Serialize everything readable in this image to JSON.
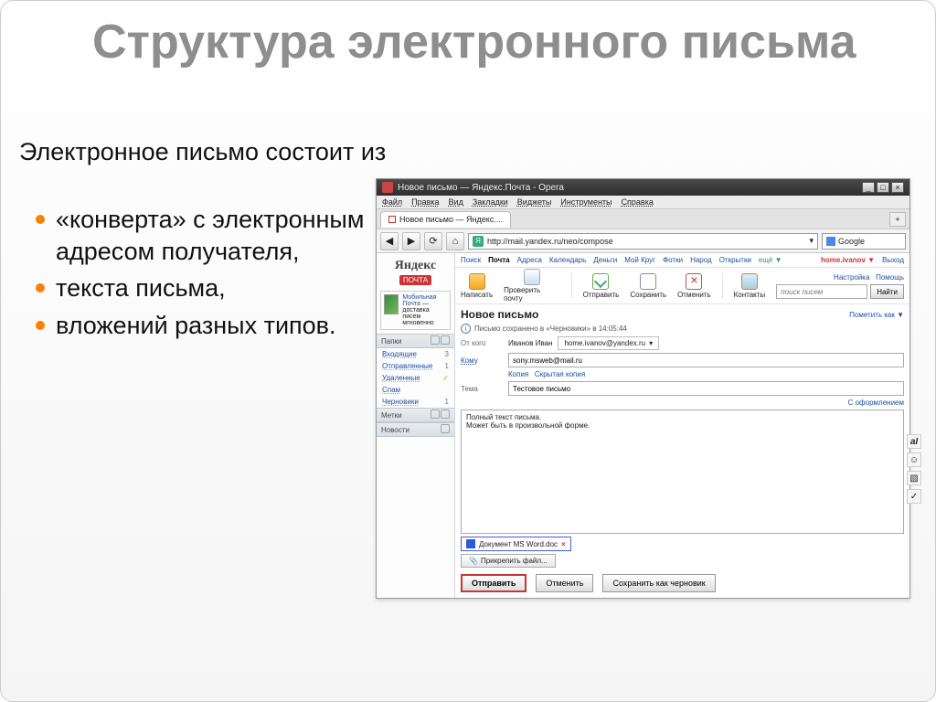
{
  "slide": {
    "title": "Структура электронного письма",
    "intro": "Электронное письмо состоит из",
    "bullets": [
      "«конверта» с электронным адресом получателя,",
      "текста письма,",
      "вложений разных типов."
    ]
  },
  "window": {
    "title": "Новое письмо — Яндекс.Почта - Opera",
    "menus": [
      "Файл",
      "Правка",
      "Вид",
      "Закладки",
      "Виджеты",
      "Инструменты",
      "Справка"
    ],
    "tab": "Новое письмо — Яндекс....",
    "url": "http://mail.yandex.ru/neo/compose",
    "search_engine": "Google"
  },
  "nav": {
    "links": [
      "Поиск",
      "Почта",
      "Адреса",
      "Календарь",
      "Деньги",
      "Мой Круг",
      "Фотки",
      "Народ",
      "Открытки"
    ],
    "more": "ещё ▼",
    "user": "home.ivanov ▼",
    "settings": "Настройка",
    "exit": "Выход",
    "help": "Помощь"
  },
  "logo": {
    "main": "Яндекс",
    "service": "ПОЧТА"
  },
  "promo": {
    "link": "Мобильная Почта",
    "line1": "доставка писем",
    "line2": "мгновенно"
  },
  "sidebar": {
    "sections": {
      "folders": "Папки",
      "labels": "Метки",
      "news": "Новости"
    },
    "folders": {
      "inbox": {
        "name": "Входящие",
        "count": "3"
      },
      "sent": {
        "name": "Отправленные",
        "count": "1"
      },
      "trash": {
        "name": "Удаленные",
        "count": ""
      },
      "spam": {
        "name": "Спам",
        "count": ""
      },
      "drafts": {
        "name": "Черновики",
        "count": "1"
      }
    }
  },
  "toolbar": {
    "compose": "Написать",
    "check": "Проверить почту",
    "send": "Отправить",
    "save": "Сохранить",
    "cancel": "Отменить",
    "contacts": "Контакты",
    "search_ph": "поиск писем",
    "search_btn": "Найти"
  },
  "compose": {
    "heading": "Новое письмо",
    "mark": "Пометить как ▼",
    "saved": "Письмо сохранено в «Черновики» в 14:05:44",
    "from_lbl": "От кого",
    "from_name": "Иванов Иван",
    "from_email": "home.ivanov@yandex.ru",
    "to_lbl": "Кому",
    "to_value": "sony.msweb@mail.ru",
    "cc": "Копия",
    "bcc": "Скрытая копия",
    "subj_lbl": "Тема",
    "subj_value": "Тестовое письмо",
    "design": "С оформлением",
    "body_l1": "Полный текст письма.",
    "body_l2": "Может быть в произвольной форме.",
    "attach_name": "Документ MS Word.doc",
    "attach_btn": "Прикрепить файл...",
    "send_btn": "Отправить",
    "cancel_btn": "Отменить",
    "savedraft_btn": "Сохранить как черновик"
  }
}
